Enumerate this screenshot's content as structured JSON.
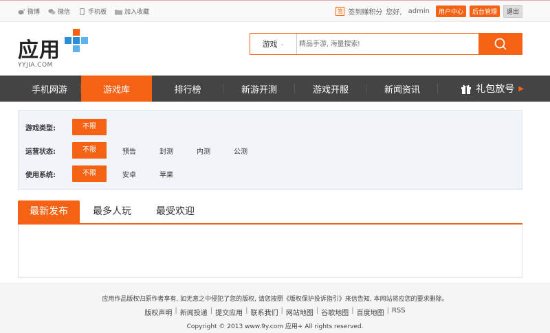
{
  "topbar": {
    "links": [
      {
        "label": "微博",
        "icon": "weibo-icon"
      },
      {
        "label": "微信",
        "icon": "wechat-icon"
      },
      {
        "label": "手机板",
        "icon": "phone-icon"
      },
      {
        "label": "加入收藏",
        "icon": "folder-icon"
      }
    ],
    "sign_label": "签到赚积分",
    "greeting": "您好,",
    "username": "admin",
    "user_center": "用户中心",
    "admin_panel": "后台管理",
    "logout": "退出"
  },
  "logo": {
    "text": "应用",
    "sub": "YYJIA.COM"
  },
  "search": {
    "type_label": "游戏",
    "placeholder": "精品手游, 海量搜索!"
  },
  "nav": {
    "items": [
      "手机网游",
      "游戏库",
      "排行榜",
      "新游开测",
      "游戏开服",
      "新闻资讯"
    ],
    "active_index": 1,
    "gift_label": "礼包放号"
  },
  "filter": {
    "rows": [
      {
        "label": "游戏类型:",
        "options": [
          "不限"
        ]
      },
      {
        "label": "运营状态:",
        "options": [
          "不限",
          "预告",
          "封测",
          "内测",
          "公测"
        ]
      },
      {
        "label": "使用系统:",
        "options": [
          "不限",
          "安卓",
          "苹果"
        ]
      }
    ]
  },
  "tabs": [
    "最新发布",
    "最多人玩",
    "最受欢迎"
  ],
  "footer": {
    "notice": "应用作品版权归原作者享有, 如无意之中侵犯了您的版权, 请您按照《版权保护投诉指引》来信告知, 本网站将应您的要求删除。",
    "links": [
      "版权声明",
      "新闻投递",
      "提交应用",
      "联系我们",
      "网站地图",
      "谷歌地图",
      "百度地图",
      "RSS"
    ],
    "copyright": "Copyright © 2013  www.9y.com  应用+  All rights reserved."
  },
  "colors": {
    "accent": "#f56214",
    "nav_bg": "#444444",
    "filter_bg": "#f1f5fa"
  }
}
